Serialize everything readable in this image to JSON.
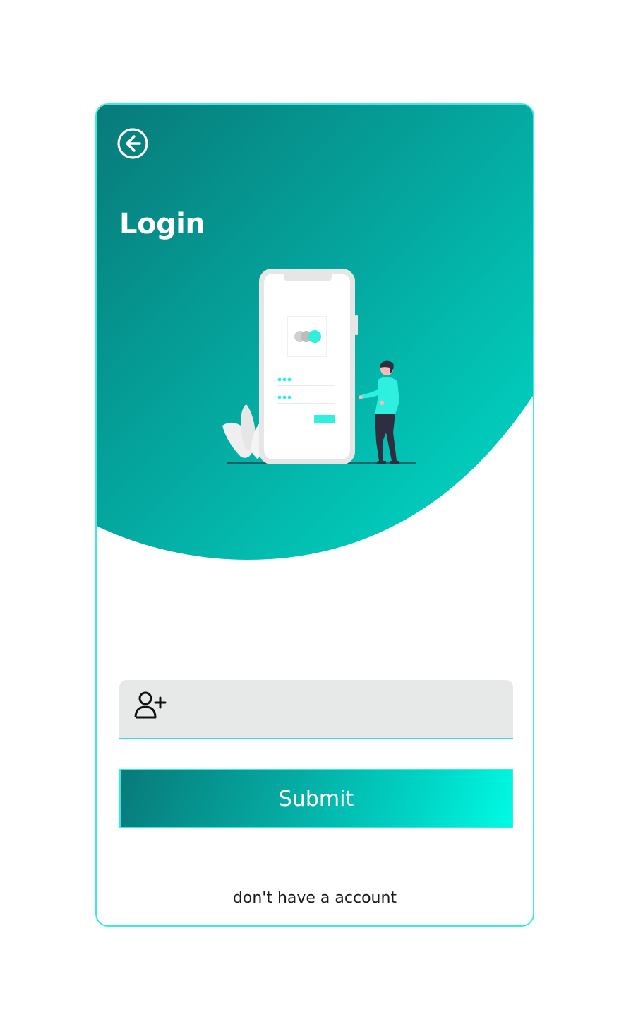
{
  "page": {
    "title": "Login"
  },
  "form": {
    "input_value": "",
    "input_placeholder": "",
    "submit_label": "Submit"
  },
  "footer": {
    "signup_text": "don't have a account"
  },
  "icons": {
    "back": "arrow-left-circle-icon",
    "user": "user-plus-icon"
  },
  "colors": {
    "gradient_dark": "#087a7a",
    "gradient_light": "#00f5e0",
    "accent_border": "#3ee9df",
    "input_bg": "#e7e9e9",
    "person_shirt": "#2ff0de",
    "person_pants": "#2f2e41"
  }
}
